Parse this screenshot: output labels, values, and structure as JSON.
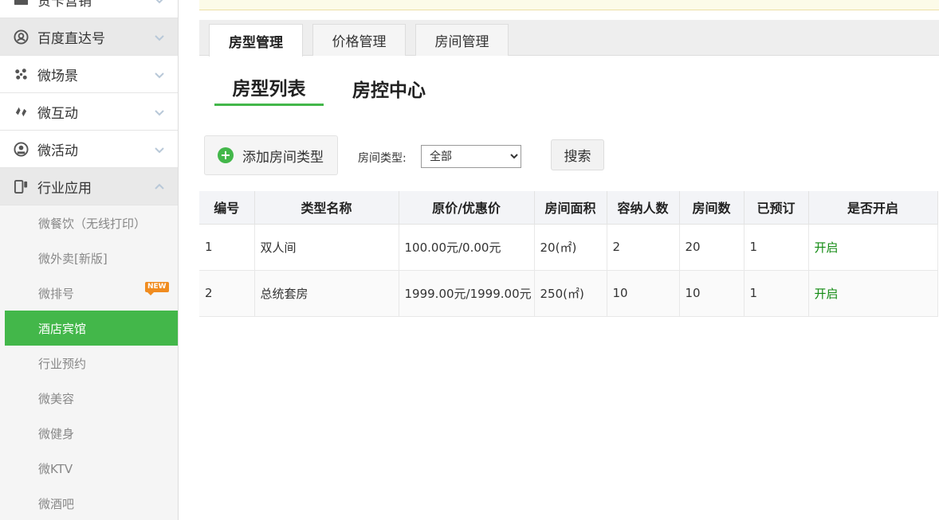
{
  "sidebar": {
    "items": [
      {
        "label": "贺卡营销",
        "icon": "card-icon"
      },
      {
        "label": "百度直达号",
        "icon": "user-circle-icon"
      },
      {
        "label": "微场景",
        "icon": "scene-icon"
      },
      {
        "label": "微互动",
        "icon": "interact-icon"
      },
      {
        "label": "微活动",
        "icon": "activity-icon"
      },
      {
        "label": "行业应用",
        "icon": "industry-icon"
      }
    ],
    "sub_items": [
      {
        "label": "微餐饮（无线打印）"
      },
      {
        "label": "微外卖[新版]"
      },
      {
        "label": "微排号",
        "badge": "NEW"
      },
      {
        "label": "酒店宾馆"
      },
      {
        "label": "行业预约"
      },
      {
        "label": "微美容"
      },
      {
        "label": "微健身"
      },
      {
        "label": "微KTV"
      },
      {
        "label": "微酒吧"
      }
    ]
  },
  "tabs": [
    {
      "label": "房型管理"
    },
    {
      "label": "价格管理"
    },
    {
      "label": "房间管理"
    }
  ],
  "subtabs": [
    {
      "label": "房型列表"
    },
    {
      "label": "房控中心"
    }
  ],
  "toolbar": {
    "add_label": "添加房间类型",
    "filter_label": "房间类型:",
    "select_value": "全部",
    "search_label": "搜索"
  },
  "table": {
    "headers": [
      "编号",
      "类型名称",
      "原价/优惠价",
      "房间面积",
      "容纳人数",
      "房间数",
      "已预订",
      "是否开启"
    ],
    "rows": [
      [
        "1",
        "双人间",
        "100.00元/0.00元",
        "20(㎡)",
        "2",
        "20",
        "1",
        "开启"
      ],
      [
        "2",
        "总统套房",
        "1999.00元/1999.00元",
        "250(㎡)",
        "10",
        "10",
        "1",
        "开启"
      ]
    ]
  },
  "colors": {
    "accent": "#43b74a",
    "status_on": "#118a11",
    "badge": "#f08c20"
  }
}
